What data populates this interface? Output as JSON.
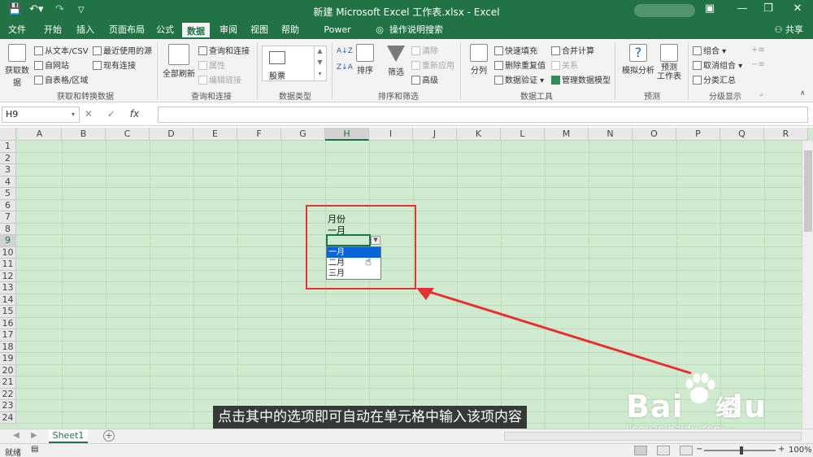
{
  "window": {
    "title": "新建 Microsoft Excel 工作表.xlsx  -  Excel",
    "quick_access": [
      "save-icon",
      "undo-icon",
      "redo-icon",
      "customize-icon"
    ],
    "controls": {
      "restore_ribbon": "▣",
      "minimize": "—",
      "maximize": "❐",
      "close": "✕"
    }
  },
  "tabs": {
    "items": [
      "文件",
      "开始",
      "插入",
      "页面布局",
      "公式",
      "数据",
      "审阅",
      "视图",
      "帮助",
      "Power Pivot",
      "操作说明搜索"
    ],
    "active": "数据",
    "share": "共享"
  },
  "ribbon": {
    "get_data": "获取数据",
    "from_text_csv": "从文本/CSV",
    "from_web": "自网站",
    "from_table": "自表格/区域",
    "recent_sources": "最近使用的源",
    "existing_connections": "现有连接",
    "group_get_transform": "获取和转换数据",
    "refresh_all": "全部刷新",
    "queries_connections": "查询和连接",
    "properties": "属性",
    "edit_links": "编辑链接",
    "group_queries": "查询和连接",
    "stocks": "股票",
    "group_data_types": "数据类型",
    "sort": "排序",
    "filter": "筛选",
    "clear": "清除",
    "reapply": "重新应用",
    "advanced": "高级",
    "group_sort_filter": "排序和筛选",
    "text_to_columns": "分列",
    "flash_fill": "快速填充",
    "remove_duplicates": "删除重复值",
    "data_validation": "数据验证",
    "consolidate": "合并计算",
    "relationships": "关系",
    "manage_data_model": "管理数据模型",
    "group_data_tools": "数据工具",
    "what_if": "模拟分析",
    "forecast_sheet": "预测\n工作表",
    "group_forecast": "预测",
    "group": "组合",
    "ungroup": "取消组合",
    "subtotal": "分类汇总",
    "group_outline": "分级显示"
  },
  "formula_bar": {
    "name_box": "H9",
    "cancel": "✕",
    "enter": "✓",
    "fx": "fx",
    "value": ""
  },
  "sheet": {
    "columns": [
      "A",
      "B",
      "C",
      "D",
      "E",
      "F",
      "G",
      "H",
      "I",
      "J",
      "K",
      "L",
      "M",
      "N",
      "O",
      "P",
      "Q",
      "R"
    ],
    "rows": [
      "1",
      "2",
      "3",
      "4",
      "5",
      "6",
      "7",
      "8",
      "9",
      "10",
      "11",
      "12",
      "13",
      "14",
      "15",
      "16",
      "17",
      "18",
      "19",
      "20",
      "21",
      "22",
      "23",
      "24"
    ],
    "selected_column": "H",
    "selected_row": "9",
    "cells": {
      "H7": "月份",
      "H8": "一月"
    },
    "dropdown_options": [
      "一月",
      "二月",
      "三月"
    ],
    "dropdown_highlighted": "一月"
  },
  "subtitle": "点击其中的选项即可自动在单元格中输入该项内容",
  "watermark": {
    "brand": "Bai",
    "brand_tail": "du",
    "jingyan": "经验",
    "url": "jingyan.baidu.com"
  },
  "sheet_tabs": {
    "active": "Sheet1",
    "add": "+"
  },
  "status": {
    "ready": "就绪",
    "zoom": "100%",
    "zoom_minus": "−",
    "zoom_plus": "+"
  },
  "colors": {
    "excel_green": "#217346",
    "sheet_bg": "#cfeacf",
    "highlight_box": "#e83030",
    "selection_blue": "#0a64d6"
  }
}
